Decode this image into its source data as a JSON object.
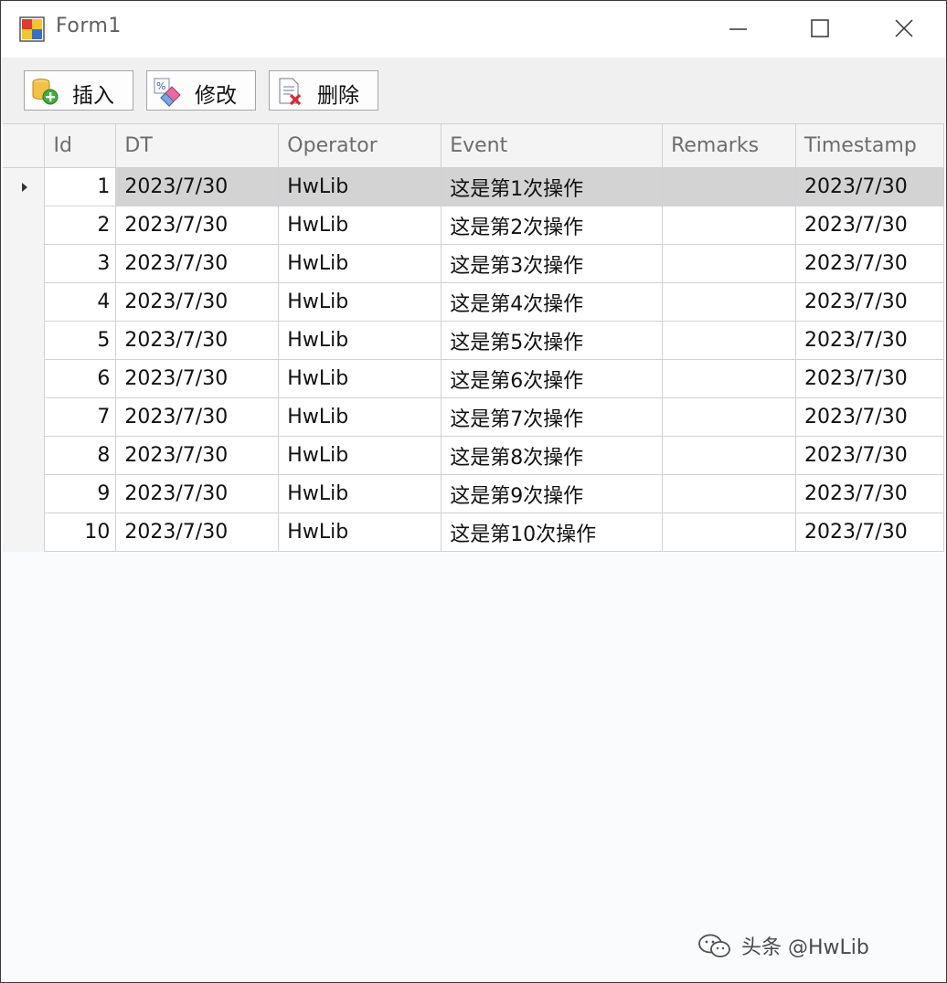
{
  "window": {
    "title": "Form1"
  },
  "toolbar": {
    "insert_label": "插入",
    "edit_label": "修改",
    "delete_label": "删除"
  },
  "grid": {
    "columns": [
      "Id",
      "DT",
      "Operator",
      "Event",
      "Remarks",
      "Timestamp"
    ],
    "selected_row": 1,
    "rows": [
      {
        "id": "1",
        "dt": "2023/7/30",
        "operator": "HwLib",
        "event": "这是第1次操作",
        "remarks": "",
        "timestamp": "2023/7/30"
      },
      {
        "id": "2",
        "dt": "2023/7/30",
        "operator": "HwLib",
        "event": "这是第2次操作",
        "remarks": "",
        "timestamp": "2023/7/30"
      },
      {
        "id": "3",
        "dt": "2023/7/30",
        "operator": "HwLib",
        "event": "这是第3次操作",
        "remarks": "",
        "timestamp": "2023/7/30"
      },
      {
        "id": "4",
        "dt": "2023/7/30",
        "operator": "HwLib",
        "event": "这是第4次操作",
        "remarks": "",
        "timestamp": "2023/7/30"
      },
      {
        "id": "5",
        "dt": "2023/7/30",
        "operator": "HwLib",
        "event": "这是第5次操作",
        "remarks": "",
        "timestamp": "2023/7/30"
      },
      {
        "id": "6",
        "dt": "2023/7/30",
        "operator": "HwLib",
        "event": "这是第6次操作",
        "remarks": "",
        "timestamp": "2023/7/30"
      },
      {
        "id": "7",
        "dt": "2023/7/30",
        "operator": "HwLib",
        "event": "这是第7次操作",
        "remarks": "",
        "timestamp": "2023/7/30"
      },
      {
        "id": "8",
        "dt": "2023/7/30",
        "operator": "HwLib",
        "event": "这是第8次操作",
        "remarks": "",
        "timestamp": "2023/7/30"
      },
      {
        "id": "9",
        "dt": "2023/7/30",
        "operator": "HwLib",
        "event": "这是第9次操作",
        "remarks": "",
        "timestamp": "2023/7/30"
      },
      {
        "id": "10",
        "dt": "2023/7/30",
        "operator": "HwLib",
        "event": "这是第10次操作",
        "remarks": "",
        "timestamp": "2023/7/30"
      }
    ]
  },
  "watermark": {
    "text": "头条 @HwLib"
  },
  "icons": {
    "app": "form-app-icon",
    "minimize": "minimize-icon",
    "maximize": "maximize-icon",
    "close": "close-icon",
    "insert": "database-add-icon",
    "edit": "edit-eraser-icon",
    "delete": "document-delete-icon",
    "row_pointer": "row-pointer-icon",
    "watermark": "wechat-icon"
  },
  "colors": {
    "selected_row": "#d3d3d3",
    "header_bg": "#f4f4f4",
    "toolbar_bg": "#f0f0f0",
    "grid_bg": "#f9fbfd"
  }
}
